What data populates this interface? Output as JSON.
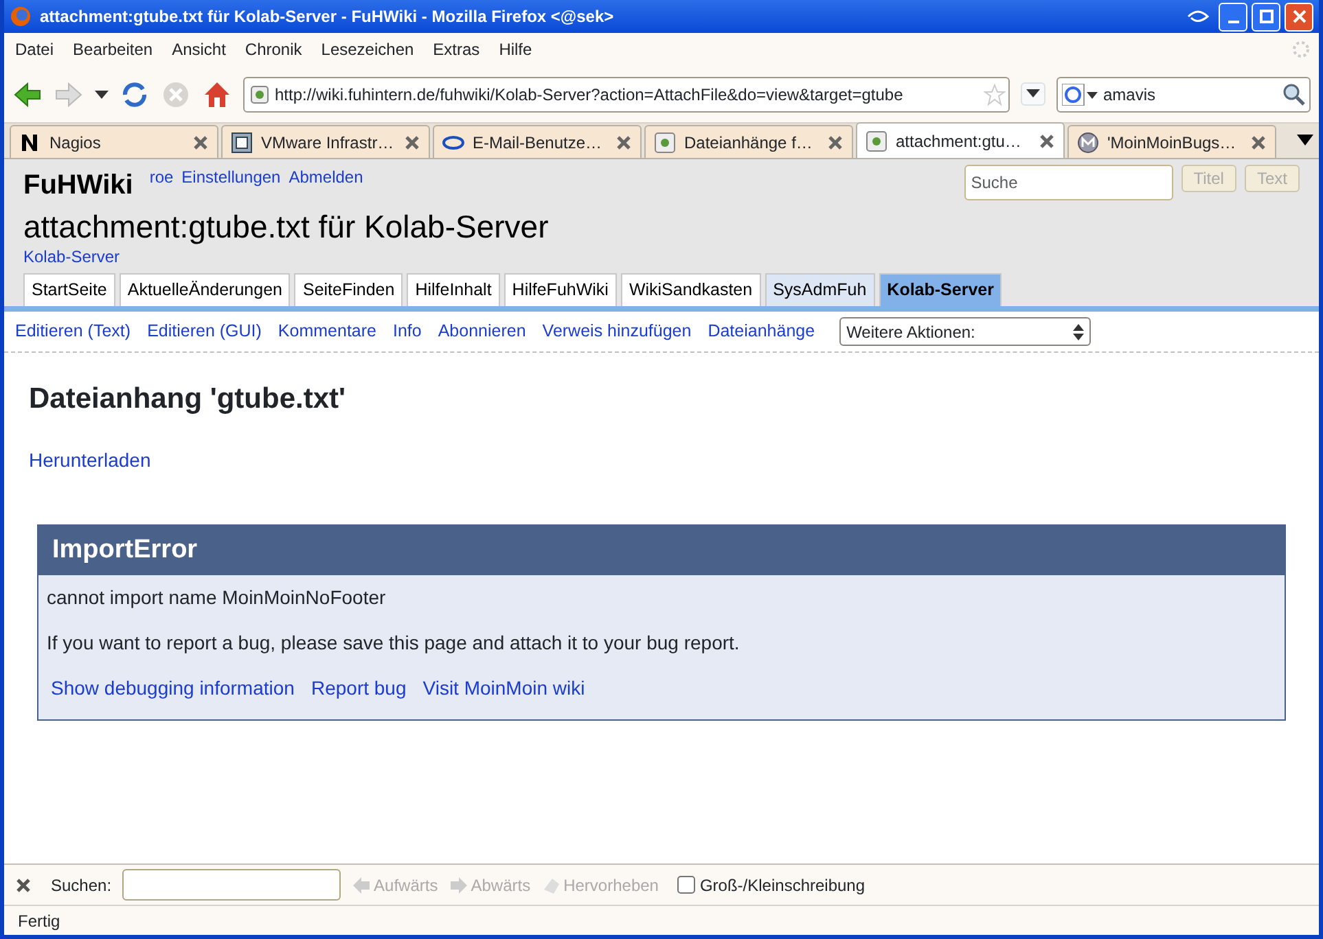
{
  "window": {
    "title": "attachment:gtube.txt für Kolab-Server - FuHWiki - Mozilla Firefox <@sek>"
  },
  "menu": [
    "Datei",
    "Bearbeiten",
    "Ansicht",
    "Chronik",
    "Lesezeichen",
    "Extras",
    "Hilfe"
  ],
  "toolbar": {
    "url": "http://wiki.fuhintern.de/fuhwiki/Kolab-Server?action=AttachFile&do=view&target=gtube",
    "search_value": "amavis"
  },
  "tabs": [
    {
      "label": "Nagios",
      "selected": false
    },
    {
      "label": "VMware Infrastr…",
      "selected": false
    },
    {
      "label": "E-Mail-Benutze…",
      "selected": false
    },
    {
      "label": "Dateianhänge f…",
      "selected": false
    },
    {
      "label": "attachment:gtu…",
      "selected": true
    },
    {
      "label": "'MoinMoinBugs…",
      "selected": false
    }
  ],
  "wiki": {
    "logo": "FuHWiki",
    "user_links": [
      "roe",
      "Einstellungen",
      "Abmelden"
    ],
    "search": {
      "placeholder": "Suche",
      "buttons": [
        "Titel",
        "Text"
      ]
    },
    "page_title": "attachment:gtube.txt für Kolab-Server",
    "breadcrumb": "Kolab-Server",
    "nav": [
      {
        "label": "StartSeite",
        "selected": false,
        "visited": false
      },
      {
        "label": "AktuelleÄnderungen",
        "selected": false,
        "visited": false
      },
      {
        "label": "SeiteFinden",
        "selected": false,
        "visited": false
      },
      {
        "label": "HilfeInhalt",
        "selected": false,
        "visited": false
      },
      {
        "label": "HilfeFuhWiki",
        "selected": false,
        "visited": false
      },
      {
        "label": "WikiSandkasten",
        "selected": false,
        "visited": false
      },
      {
        "label": "SysAdmFuh",
        "selected": false,
        "visited": true
      },
      {
        "label": "Kolab-Server",
        "selected": true,
        "visited": false
      }
    ],
    "actions": [
      "Editieren (Text)",
      "Editieren (GUI)",
      "Kommentare",
      "Info",
      "Abonnieren",
      "Verweis hinzufügen",
      "Dateianhänge"
    ],
    "more_actions": "Weitere Aktionen:",
    "heading": "Dateianhang 'gtube.txt'",
    "download": "Herunterladen",
    "error": {
      "title": "ImportError",
      "message": "cannot import name MoinMoinNoFooter",
      "hint": "If you want to report a bug, please save this page and attach it to your bug report.",
      "links": [
        "Show debugging information",
        "Report bug",
        "Visit MoinMoin wiki"
      ]
    }
  },
  "find_bar": {
    "label": "Suchen:",
    "buttons": [
      "Aufwärts",
      "Abwärts",
      "Hervorheben"
    ],
    "match_case": {
      "label": "Groß-/Kleinschreibung",
      "checked": false
    }
  },
  "status_bar": "Fertig"
}
